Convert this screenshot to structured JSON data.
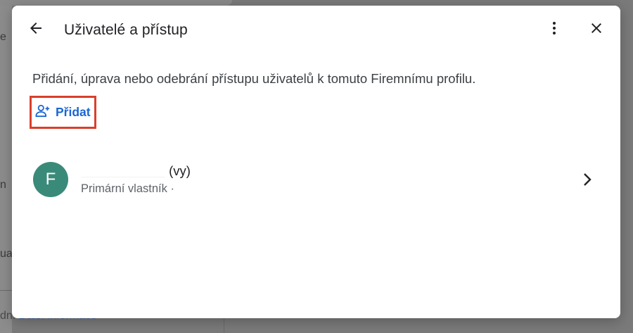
{
  "background": {
    "fragment_e": "e",
    "fragment_n": "n",
    "fragment_ua": "ua",
    "fragment_bottom_prefix": "dn:",
    "fragment_bottom_link": "Další informace"
  },
  "dialog": {
    "title": "Uživatelé a přístup",
    "back_icon": "arrow-back-icon",
    "more_icon": "more-vert-icon",
    "close_icon": "close-icon",
    "description": "Přidání, úprava nebo odebrání přístupu uživatelů k tomuto Firemnímu profilu.",
    "add_button": {
      "label": "Přidat",
      "icon": "person-add-icon",
      "highlight_color": "#d9402c"
    }
  },
  "users": [
    {
      "avatar_letter": "F",
      "name_suffix": "(vy)",
      "role": "Primární vlastník ·",
      "avatar_color": "#3a8a7a"
    }
  ],
  "colors": {
    "accent": "#1a66d2",
    "text_primary": "#202124",
    "text_secondary": "#5f6368"
  }
}
